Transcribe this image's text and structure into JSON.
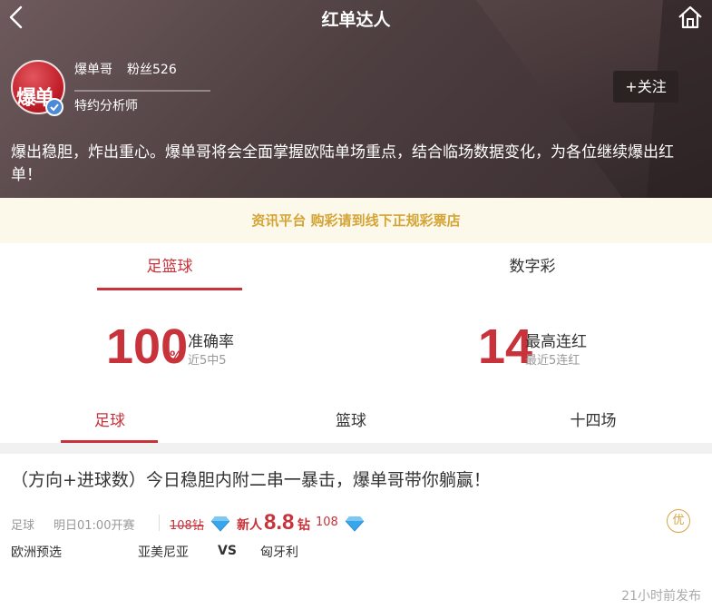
{
  "header": {
    "title": "红单达人",
    "back_icon": "chevron-left-icon",
    "home_icon": "home-icon"
  },
  "profile": {
    "avatar_text": "爆单",
    "username": "爆单哥",
    "fans": "粉丝526",
    "role": "特约分析师",
    "follow_label": "+关注",
    "intro": "爆出稳胆，炸出重心。爆单哥将会全面掌握欧陆单场重点，结合临场数据变化，为各位继续爆出红单！"
  },
  "notice": {
    "text": "资讯平台 购彩请到线下正规彩票店"
  },
  "category_tabs": [
    {
      "label": "足篮球",
      "active": true
    },
    {
      "label": "数字彩",
      "active": false
    }
  ],
  "stats": {
    "accuracy": {
      "value": "100",
      "unit": "%",
      "label": "准确率",
      "sub": "近5中5"
    },
    "streak": {
      "value": "14",
      "label": "最高连红",
      "sub": "最近5连红"
    }
  },
  "sport_tabs": [
    {
      "label": "足球",
      "active": true
    },
    {
      "label": "篮球",
      "active": false
    },
    {
      "label": "十四场",
      "active": false
    }
  ],
  "article": {
    "title": "（方向+进球数）今日稳胆内附二串一暴击，爆单哥带你躺赢！",
    "sport": "足球",
    "kickoff": "明日01:00开赛",
    "old_price": "108钻",
    "newbie_label": "新人",
    "new_price": "8.8",
    "new_unit": "钻",
    "regular_price": "108",
    "badge": "优",
    "league": "欧洲预选",
    "home_team": "亚美尼亚",
    "vs": "VS",
    "away_team": "匈牙利",
    "published": "21小时前发布"
  },
  "colors": {
    "accent": "#c8323a",
    "notice_text": "#d4a437",
    "notice_bg": "#fdf9ea",
    "diamond": "#3aa6ea"
  }
}
